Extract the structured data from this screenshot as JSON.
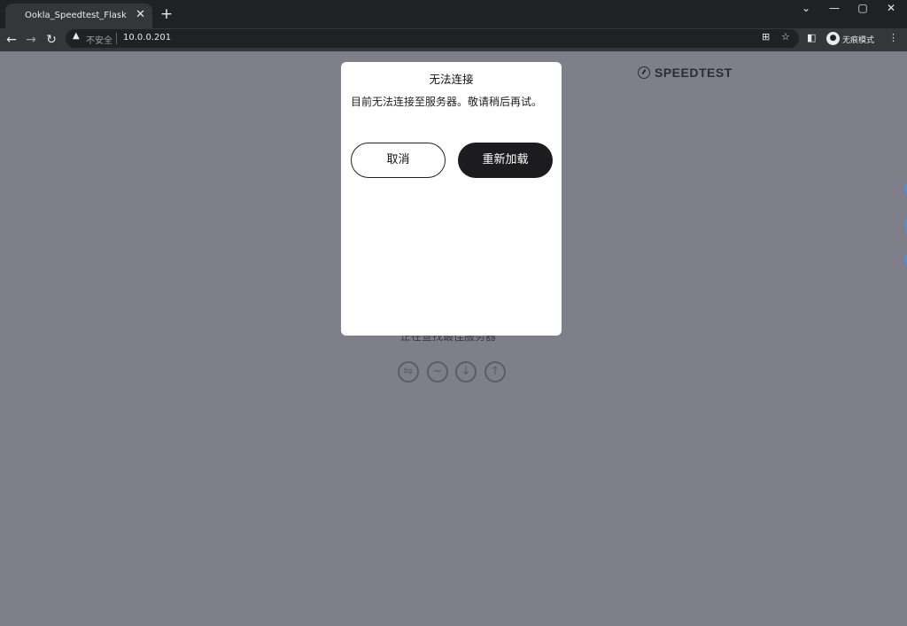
{
  "browser": {
    "tab_title": "Ookla_Speedtest_Flask",
    "tab_close": "✕",
    "new_tab": "+",
    "security_label": "不安全",
    "url": "10.0.0.201",
    "profile_label": "无痕模式",
    "window_controls": {
      "collapse": "⌄",
      "minimize": "—",
      "maximize": "▢",
      "close": "✕"
    }
  },
  "page": {
    "logo_text": "SPEEDTEST",
    "background_status": "正在查找最佳服务器",
    "metric_icons": [
      "ping-icon",
      "jitter-icon",
      "download-icon",
      "upload-icon"
    ]
  },
  "dialog": {
    "title": "无法连接",
    "message": "目前无法连接至服务器。敬请稍后再试。",
    "cancel_label": "取消",
    "reload_label": "重新加载"
  },
  "colors": {
    "overlay": "#7f7f8a",
    "dialog_bg": "#ffffff",
    "primary_button": "#1c1c1e"
  }
}
